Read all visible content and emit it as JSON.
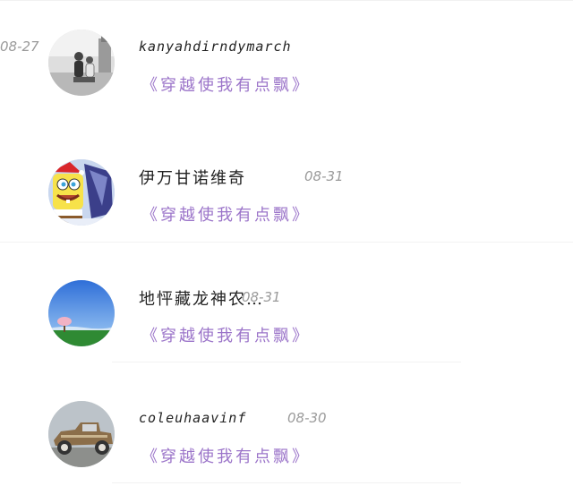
{
  "comments": [
    {
      "username": "伊万甘诺维奇",
      "date": "08-31",
      "reply_link": "《穿越使我有点飘》",
      "avatar_icon": "spongebob-avatar-icon"
    },
    {
      "username": "地怦藏龙神农…",
      "date": "08-31",
      "reply_link": "《穿越使我有点飘》",
      "avatar_icon": "landscape-tree-avatar-icon"
    },
    {
      "username": "coleuhaavinf",
      "date": "08-30",
      "reply_link": "《穿越使我有点飘》",
      "avatar_icon": "vintage-car-avatar-icon"
    },
    {
      "username": "kanyahdirndymarch",
      "date": "08-27",
      "reply_link": "《穿越使我有点飘》",
      "avatar_icon": "couple-photo-avatar-icon"
    }
  ],
  "colors": {
    "reply_link": "#9b74c9",
    "date": "#9a9a9a",
    "username": "#222222",
    "divider": "#f2f2f2"
  }
}
